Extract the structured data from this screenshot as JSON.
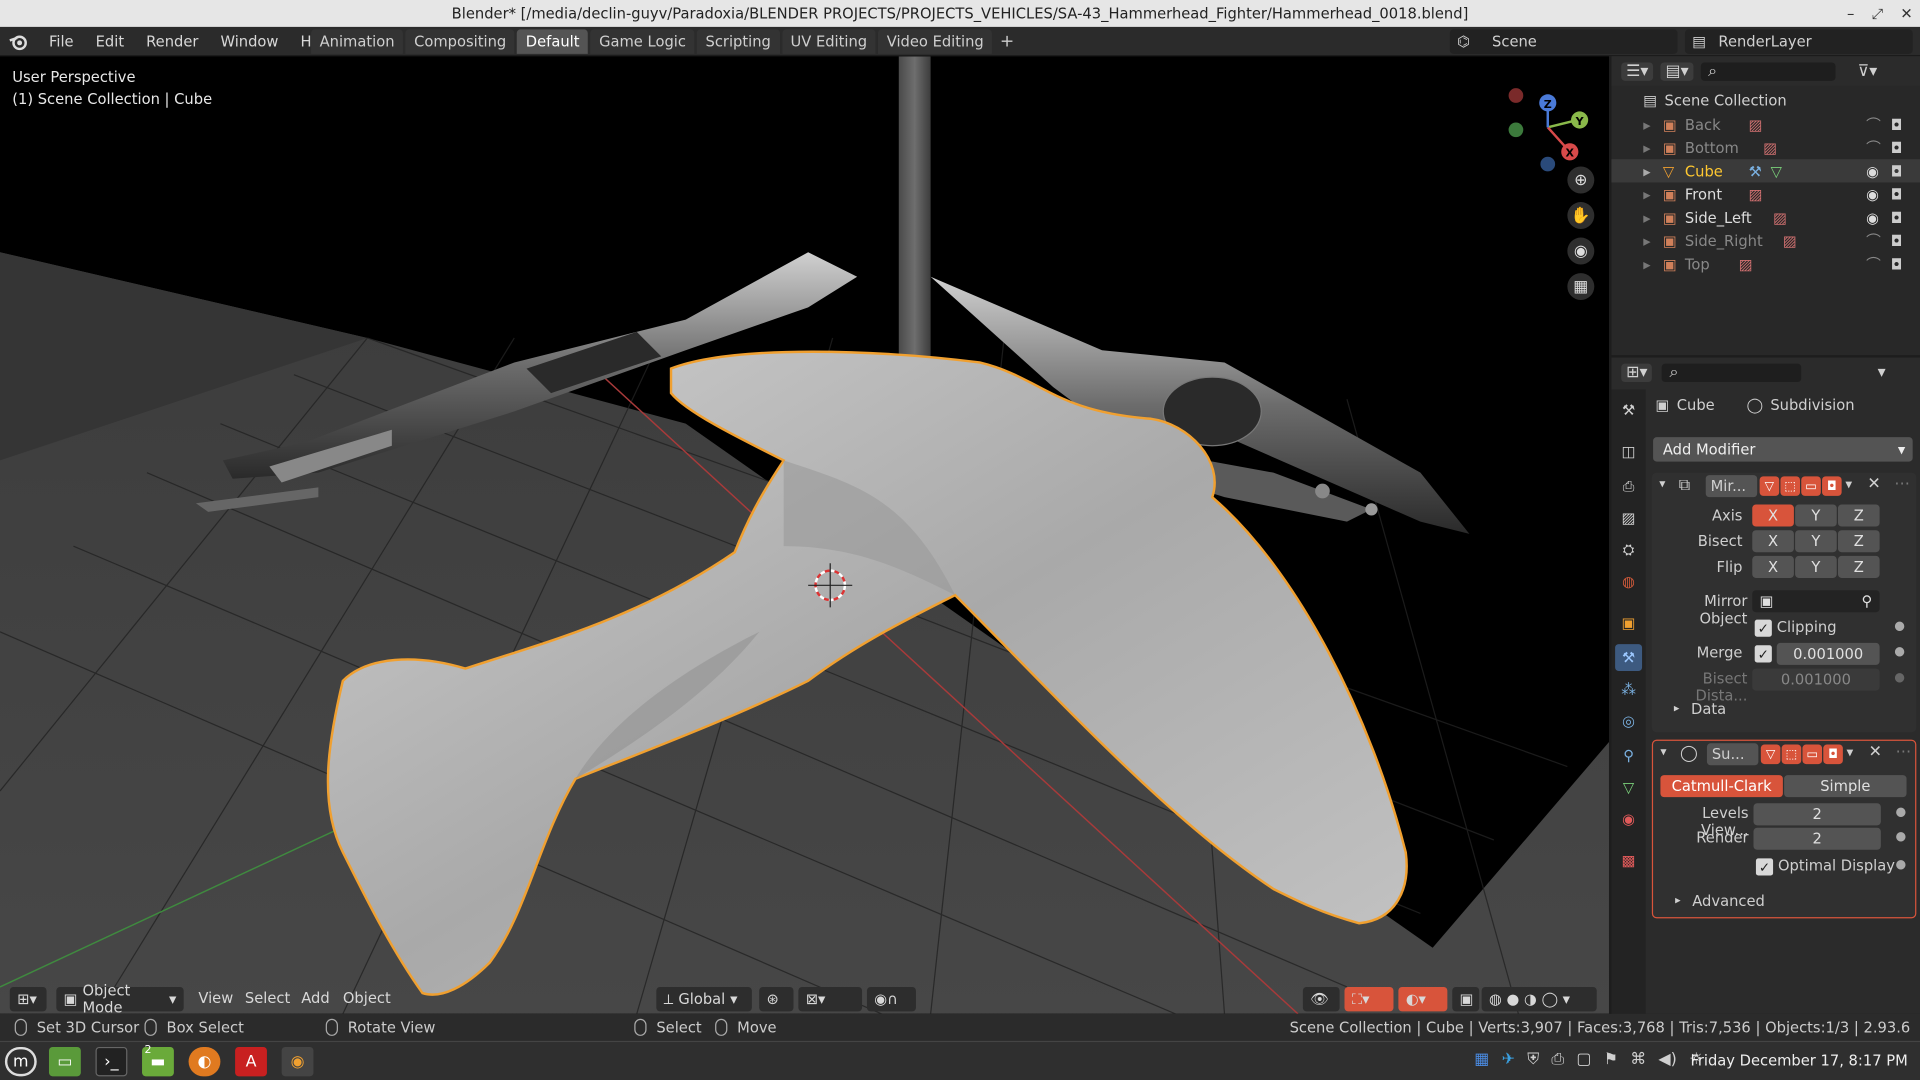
{
  "window": {
    "title": "Blender* [/media/declin-guyv/Paradoxia/BLENDER PROJECTS/PROJECTS_VEHICLES/SA-43_Hammerhead_Fighter/Hammerhead_0018.blend]",
    "minimize": "–",
    "maximize": "⤢",
    "close": "✕"
  },
  "menu": [
    "File",
    "Edit",
    "Render",
    "Window",
    "Help"
  ],
  "workspaces": {
    "tabs": [
      "Animation",
      "Compositing",
      "Default",
      "Game Logic",
      "Scripting",
      "UV Editing",
      "Video Editing"
    ],
    "active": "Default",
    "add": "+"
  },
  "scene": {
    "name": "Scene",
    "render_layer": "RenderLayer"
  },
  "viewport": {
    "view_name": "User Perspective",
    "collection_info": "(1) Scene Collection | Cube",
    "gizmo": {
      "x": "X",
      "y": "Y",
      "z": "Z"
    }
  },
  "viewport_header": {
    "mode": "Object Mode",
    "menus": [
      "View",
      "Select",
      "Add",
      "Object"
    ],
    "orientation": "Global"
  },
  "statusbar": {
    "left_action": "Set 3D Cursor",
    "middle_action": "Box Select",
    "right_action": "Rotate View",
    "select": "Select",
    "move": "Move",
    "stats": "Scene Collection | Cube | Verts:3,907 | Faces:3,768 | Tris:7,536 | Objects:1/3 | 2.93.6"
  },
  "taskbar": {
    "clock": "Friday December 17, 8:17 PM",
    "workspace_badge": "2"
  },
  "outliner": {
    "root": "Scene Collection",
    "items": [
      {
        "name": "Back",
        "visible": false
      },
      {
        "name": "Bottom",
        "visible": false
      },
      {
        "name": "Cube",
        "visible": true,
        "selected": true
      },
      {
        "name": "Front",
        "visible": true
      },
      {
        "name": "Side_Left",
        "visible": true
      },
      {
        "name": "Side_Right",
        "visible": false
      },
      {
        "name": "Top",
        "visible": false
      }
    ]
  },
  "properties": {
    "object": "Cube",
    "modifier_context": "Subdivision",
    "add_modifier": "Add Modifier",
    "mirror": {
      "name": "Mir...",
      "axis_label": "Axis",
      "bisect_label": "Bisect",
      "flip_label": "Flip",
      "axes": [
        "X",
        "Y",
        "Z"
      ],
      "mirror_object_label": "Mirror Object",
      "clipping_label": "Clipping",
      "merge_label": "Merge",
      "merge_value": "0.001000",
      "bisect_distance_label": "Bisect Dista...",
      "bisect_distance_value": "0.001000",
      "data_label": "Data"
    },
    "subsurf": {
      "name": "Su...",
      "catmull_clark": "Catmull-Clark",
      "simple": "Simple",
      "levels_viewport_label": "Levels View...",
      "levels_viewport_value": "2",
      "render_label": "Render",
      "render_value": "2",
      "optimal_display_label": "Optimal Display",
      "advanced_label": "Advanced"
    }
  },
  "colors": {
    "accent": "#e4754a",
    "selection_outline": "#f0a030",
    "active_tab": "#545454",
    "selected_object_text": "#ffc830"
  }
}
